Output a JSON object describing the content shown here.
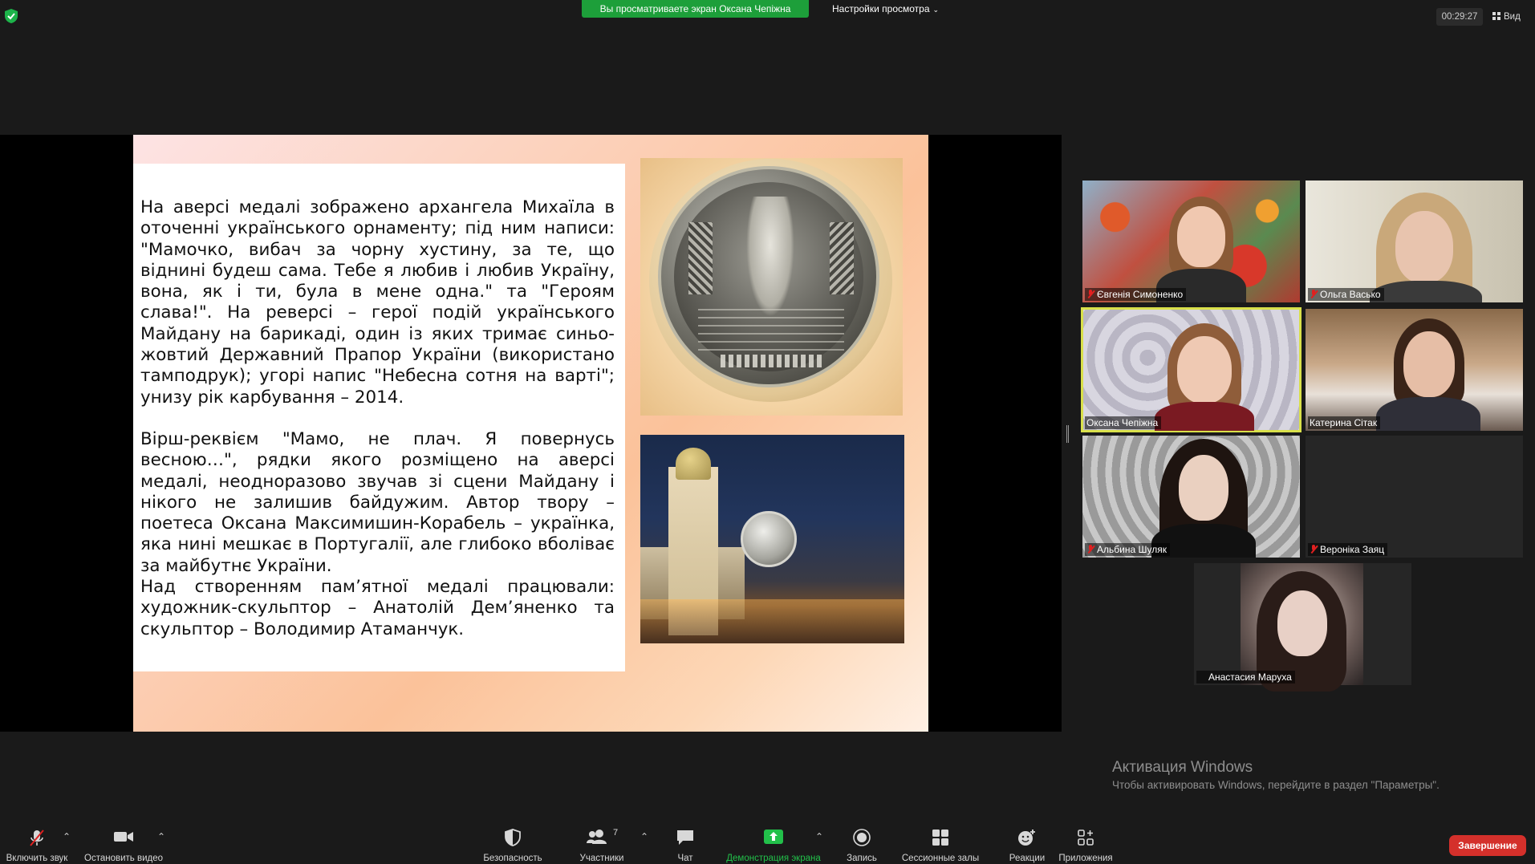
{
  "top_bar": {
    "share_banner": "Вы просматриваете экран Оксана Чепіжна",
    "view_settings": "Настройки просмотра",
    "timer": "00:29:27",
    "view_button": "Вид"
  },
  "slide": {
    "paragraph1": "На аверсі медалі зображено архангела Михаїла в оточенні українського орнаменту; під ним написи: \"Мамочко, вибач за чорну хустину, за те, що віднині будеш сама. Тебе я любив і любив Україну, вона, як і ти, була в мене одна.\" та \"Героям слава!\". На реверсі – герої подій українського Майдану на барикаді, один із яких тримає синьо-жовтий Державний Прапор України (використано тамподрук); угорі напис \"Небесна сотня на варті\"; унизу рік карбування – 2014.",
    "paragraph2": "Вірш-реквієм \"Мамо, не плач. Я повернусь весною…\", рядки якого розміщено на аверсі медалі, неодноразово звучав зі сцени Майдану і нікого не залишив байдужим. Автор твору – поетеса Оксана Максимишин-Корабель – українка, яка нині мешкає в Португалії, але глибоко вболіває за майбутнє України.",
    "paragraph3": "Над створенням пам’ятної медалі працювали: художник-скульптор – Анатолій Дем’яненко та скульптор – Володимир Атаманчук."
  },
  "participants": [
    {
      "name": "Євгенія Симоненко",
      "muted": true
    },
    {
      "name": "Ольга Васько",
      "muted": true
    },
    {
      "name": "Оксана Чепіжна",
      "muted": false,
      "active_speaker": true
    },
    {
      "name": "Катерина Сітак",
      "muted": false
    },
    {
      "name": "Альбина Шуляк",
      "muted": true
    },
    {
      "name": "Вероніка Заяц",
      "muted": true
    },
    {
      "name": "Анастасия Маруха",
      "muted": true
    }
  ],
  "windows_activation": {
    "title": "Активация Windows",
    "subtitle": "Чтобы активировать Windows, перейдите в раздел \"Параметры\"."
  },
  "toolbar": {
    "unmute": "Включить звук",
    "stop_video": "Остановить видео",
    "security": "Безопасность",
    "participants": "Участники",
    "participants_count": "7",
    "chat": "Чат",
    "share_screen": "Демонстрация экрана",
    "record": "Запись",
    "breakout_rooms": "Сессионные залы",
    "reactions": "Реакции",
    "apps": "Приложения",
    "end": "Завершение"
  },
  "colors": {
    "share_banner": "#1d9f3a",
    "active_speaker_border": "#d9e04a",
    "end_button": "#d4302b",
    "muted_mic": "#e02020"
  }
}
